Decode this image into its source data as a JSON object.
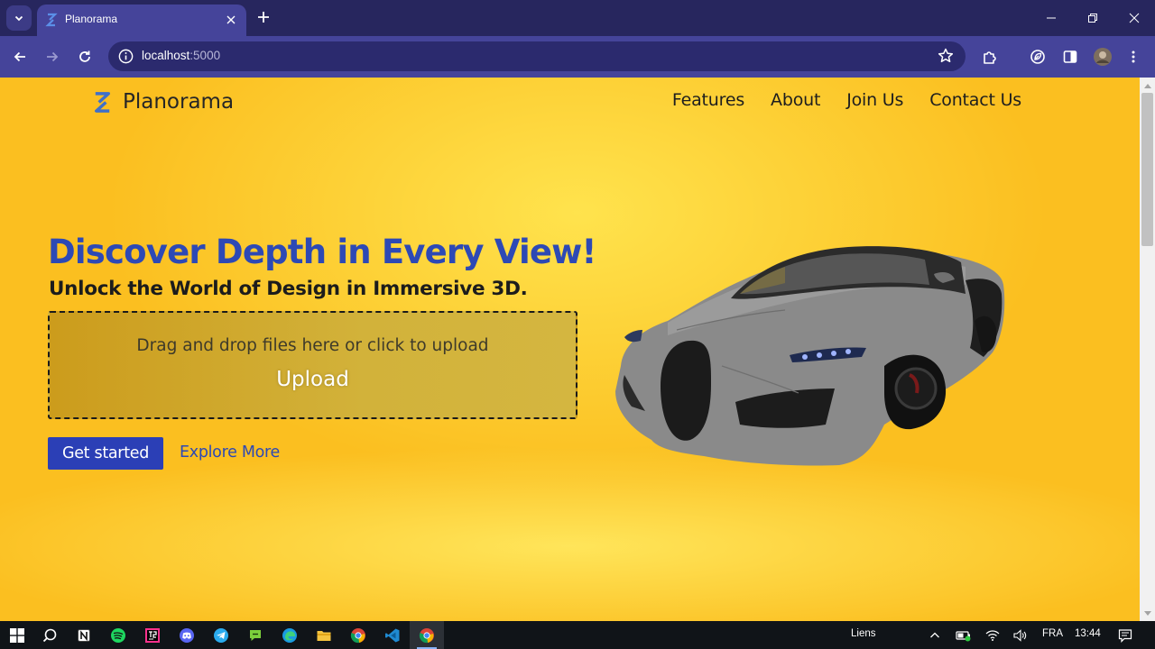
{
  "browser": {
    "tab": {
      "title": "Planorama"
    },
    "address": {
      "host": "localhost",
      "port": ":5000"
    }
  },
  "page": {
    "brand": "Planorama",
    "nav": [
      {
        "label": "Features"
      },
      {
        "label": "About"
      },
      {
        "label": "Join Us"
      },
      {
        "label": "Contact Us"
      }
    ],
    "hero": {
      "title": "Discover Depth in Every View!",
      "subtitle": "Unlock the World of Design in Immersive 3D.",
      "dropzone_text": "Drag and drop files here or click to upload",
      "upload_label": "Upload",
      "primary_cta": "Get started",
      "secondary_cta": "Explore More"
    }
  },
  "taskbar": {
    "apps": [
      "start",
      "search",
      "notion",
      "spotify",
      "jetbrains",
      "discord",
      "telegram",
      "chat",
      "edge",
      "file-explorer",
      "chrome",
      "vscode",
      "chrome-active"
    ],
    "tray": {
      "links": "Liens",
      "language": "FRA",
      "time": "13:44"
    }
  },
  "colors": {
    "tab_strip": "#27265e",
    "toolbar": "#45449a",
    "page_background": "#fbbf20",
    "accent_blue": "#2d49b5",
    "button_blue": "#2b3fb6"
  }
}
